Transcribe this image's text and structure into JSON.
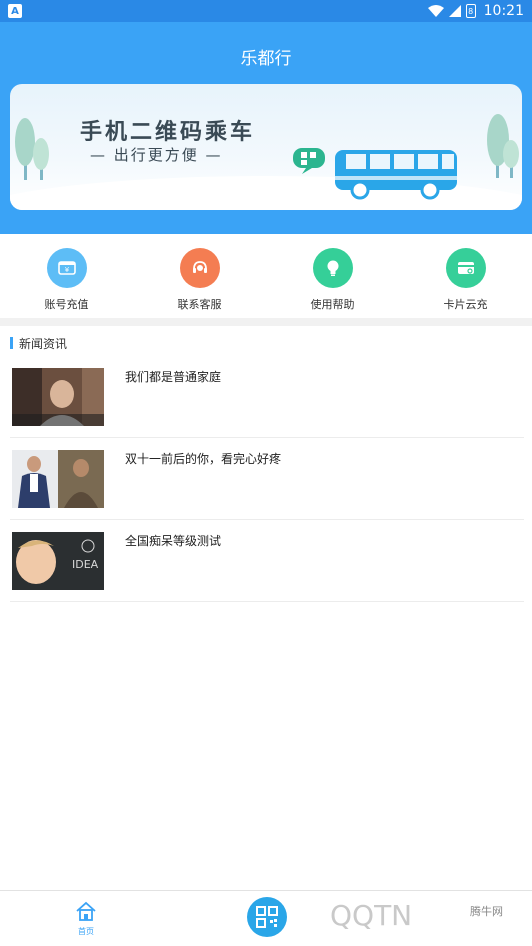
{
  "status_bar": {
    "app_badge": "A",
    "battery": "8",
    "time": "10:21"
  },
  "header": {
    "title": "乐都行"
  },
  "banner": {
    "title": "手机二维码乘车",
    "subtitle": "— 出行更方便 —"
  },
  "actions": [
    {
      "label": "账号充值",
      "icon": "wallet-icon",
      "color": "#5dbdf6"
    },
    {
      "label": "联系客服",
      "icon": "headset-icon",
      "color": "#f47d52"
    },
    {
      "label": "使用帮助",
      "icon": "lightbulb-icon",
      "color": "#35cf98"
    },
    {
      "label": "卡片云充",
      "icon": "card-icon",
      "color": "#36cf99"
    }
  ],
  "news": {
    "heading": "新闻资讯",
    "items": [
      {
        "title": "我们都是普通家庭"
      },
      {
        "title": "双十一前后的你，看完心好疼"
      },
      {
        "title": "全国痴呆等级测试"
      }
    ]
  },
  "bottom_nav": {
    "home_label": "首页",
    "watermark_site": "腾牛网"
  },
  "colors": {
    "primary": "#3aa3f6",
    "status": "#2a89e6"
  }
}
